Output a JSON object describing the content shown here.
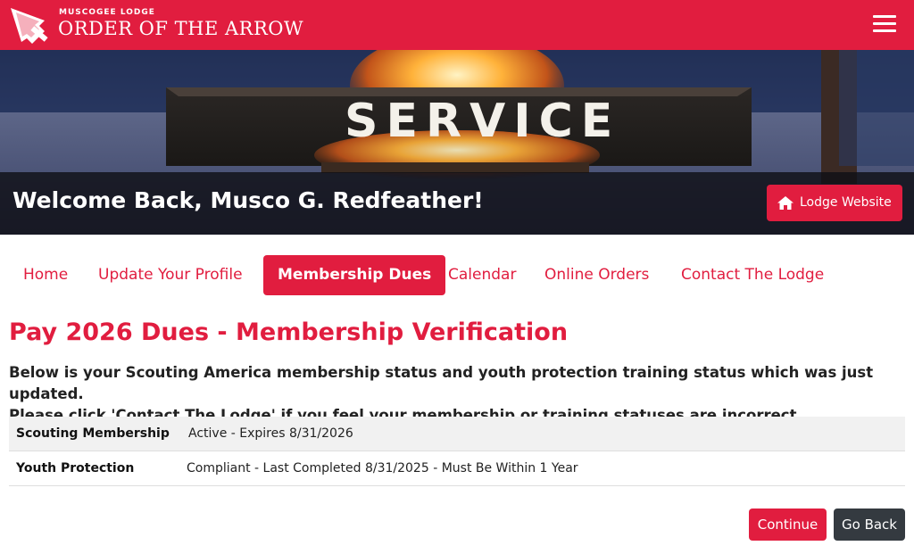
{
  "header": {
    "lodge_name": "MUSCOGEE LODGE",
    "org_name": "ORDER OF THE ARROW",
    "menu_icon": "hamburger-icon",
    "colors": {
      "brand": "#e11d3f"
    }
  },
  "hero": {
    "sign_text": "SERVICE",
    "welcome": "Welcome Back, Musco G. Redfeather!",
    "lodge_button": {
      "label": "Lodge Website",
      "icon": "home-icon"
    }
  },
  "nav": {
    "items": [
      {
        "label": "Home",
        "active": false
      },
      {
        "label": "Update Your Profile",
        "active": false
      },
      {
        "label": "Membership Dues",
        "active": true
      },
      {
        "label": "Calendar",
        "active": false
      },
      {
        "label": "Online Orders",
        "active": false
      },
      {
        "label": "Contact The Lodge",
        "active": false
      }
    ]
  },
  "main": {
    "title": "Pay 2026 Dues - Membership Verification",
    "intro_line1": "Below is your Scouting America membership status and youth protection training status which was just updated.",
    "intro_line2": "Please click 'Contact The Lodge' if you feel your membership or training statuses are incorrect.",
    "status_rows": [
      {
        "label": "Scouting Membership",
        "value": "Active - Expires 8/31/2026"
      },
      {
        "label": "Youth Protection",
        "value": "Compliant - Last Completed 8/31/2025 - Must Be Within 1 Year"
      }
    ],
    "buttons": {
      "continue": "Continue",
      "back": "Go Back"
    }
  }
}
